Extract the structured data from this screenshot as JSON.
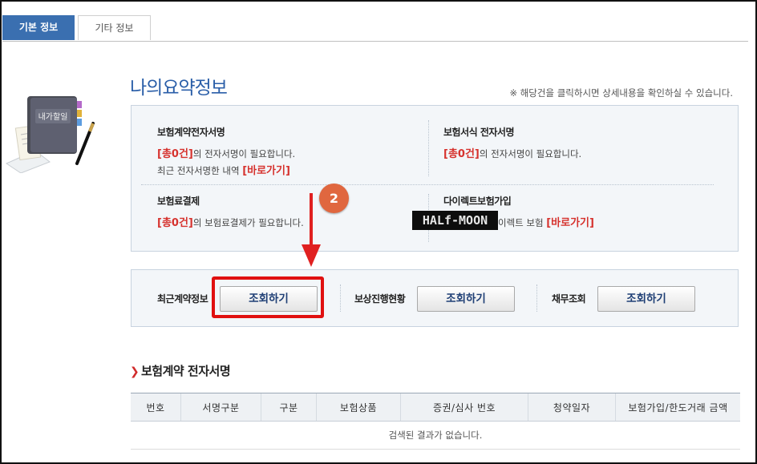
{
  "tabs": [
    {
      "label": "기본 정보",
      "active": true
    },
    {
      "label": "기타 정보",
      "active": false
    }
  ],
  "page": {
    "title": "나의요약정보",
    "hint": "※ 해당건을 클릭하시면 상세내용을 확인하실 수 있습니다."
  },
  "illustration": {
    "book_label": "내가할일",
    "icon": "planner-book-pen-icon"
  },
  "summary": {
    "contract_esign": {
      "title": "보험계약전자서명",
      "count": "[총0건]",
      "text": "의 전자서명이 필요합니다.",
      "recent_text": "최근 전자서명한 내역",
      "link": "[바로가기]"
    },
    "form_esign": {
      "title": "보험서식 전자서명",
      "count": "[총0건]",
      "text": "의 전자서명이 필요합니다."
    },
    "premium_payment": {
      "title": "보험료결제",
      "count": "[총0건]",
      "text": "의 보험료결제가 필요합니다."
    },
    "direct_join": {
      "title": "다이렉트보험가입",
      "text": "이렉트 보험",
      "link": "[바로가기]"
    },
    "watermark": "HALf-MOON"
  },
  "annotation": {
    "step_number": "2",
    "accent_color": "#e02020",
    "badge_color": "#e0673f"
  },
  "actions": [
    {
      "label": "최근계약정보",
      "button": "조회하기"
    },
    {
      "label": "보상진행현황",
      "button": "조회하기"
    },
    {
      "label": "채무조회",
      "button": "조회하기"
    }
  ],
  "section": {
    "title": "보험계약 전자서명",
    "columns": [
      "번호",
      "서명구분",
      "구분",
      "보험상품",
      "증권/심사 번호",
      "청약일자",
      "보험가입/한도거래 금액"
    ],
    "empty_text": "검색된 결과가 없습니다."
  },
  "colors": {
    "brand": "#2a5ea8",
    "tab_active": "#3a6fb0",
    "highlight": "#d6322e"
  }
}
